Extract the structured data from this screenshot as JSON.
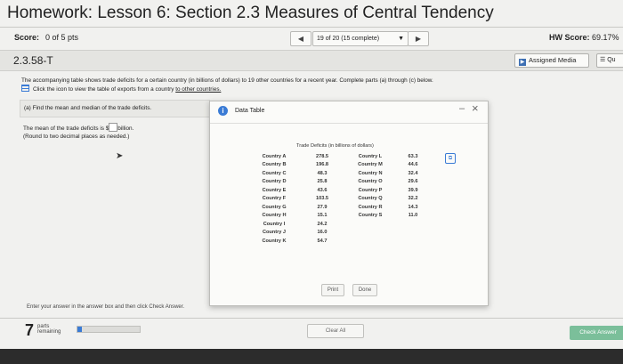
{
  "header": {
    "title": "Homework: Lesson 6: Section 2.3 Measures of Central Tendency"
  },
  "score_bar": {
    "score_label": "Score:",
    "score_value": "0 of 5 pts",
    "prev_glyph": "◀",
    "question_select": "19 of 20 (15 complete)",
    "next_glyph": "▶",
    "hw_score_label": "HW Score:",
    "hw_score_value": "69.17%"
  },
  "problem": {
    "id": "2.3.58-T",
    "assigned_media": "Assigned Media",
    "menu_label": "Qu"
  },
  "prompt": {
    "line1": "The accompanying table shows trade deficits for a certain country (in billions of dollars) to 19 other countries for a recent year. Complete parts (a) through (c) below.",
    "line2_prefix": "Click the icon to view the table of exports from a country ",
    "line2_link": "to other countries."
  },
  "part_a": {
    "label": "(a) Find the mean and median of the trade deficits.",
    "mean_prefix": "The mean of the trade deficits is $",
    "mean_suffix": "billion.",
    "round_note": "(Round to two decimal places as needed.)"
  },
  "footer": {
    "enter_answer": "Enter your answer in the answer box and then click Check Answer.",
    "parts_count": "7",
    "parts_word_1": "parts",
    "parts_word_2": "remaining",
    "progress": 0.07,
    "clear_all": "Clear All",
    "check_answer": "Check Answer"
  },
  "popup": {
    "title": "Data Table",
    "caption": "Trade Deficits (in billions of dollars)",
    "print": "Print",
    "done": "Done",
    "rows": [
      {
        "c1": "Country A",
        "v1": "278.5",
        "c2": "Country L",
        "v2": "63.3"
      },
      {
        "c1": "Country B",
        "v1": "196.8",
        "c2": "Country M",
        "v2": "44.6"
      },
      {
        "c1": "Country C",
        "v1": "48.3",
        "c2": "Country N",
        "v2": "32.4"
      },
      {
        "c1": "Country D",
        "v1": "25.8",
        "c2": "Country O",
        "v2": "29.6"
      },
      {
        "c1": "Country E",
        "v1": "43.6",
        "c2": "Country P",
        "v2": "39.9"
      },
      {
        "c1": "Country F",
        "v1": "103.5",
        "c2": "Country Q",
        "v2": "32.2"
      },
      {
        "c1": "Country G",
        "v1": "27.9",
        "c2": "Country R",
        "v2": "14.3"
      },
      {
        "c1": "Country H",
        "v1": "15.1",
        "c2": "Country S",
        "v2": "11.0"
      },
      {
        "c1": "Country I",
        "v1": "24.2",
        "c2": "",
        "v2": ""
      },
      {
        "c1": "Country J",
        "v1": "16.0",
        "c2": "",
        "v2": ""
      },
      {
        "c1": "Country K",
        "v1": "54.7",
        "c2": "",
        "v2": ""
      }
    ]
  }
}
